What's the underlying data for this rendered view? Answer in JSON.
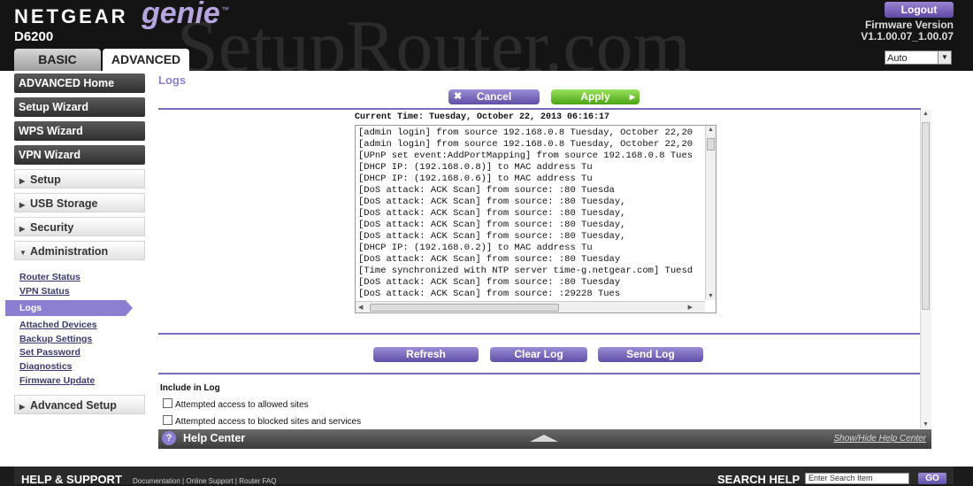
{
  "header": {
    "brand": "NETGEAR",
    "brand_product": "genie",
    "brand_tm": "™",
    "model": "D6200",
    "watermark": "SetupRouter.com",
    "tabs": [
      {
        "label": "BASIC",
        "active": false
      },
      {
        "label": "ADVANCED",
        "active": true
      }
    ],
    "logout_label": "Logout",
    "firmware_label": "Firmware Version",
    "firmware_value": "V1.1.00.07_1.00.07",
    "language_selected": "Auto"
  },
  "sidebar": {
    "primary": [
      {
        "label": "ADVANCED Home"
      },
      {
        "label": "Setup Wizard"
      },
      {
        "label": "WPS Wizard"
      },
      {
        "label": "VPN Wizard"
      }
    ],
    "sections": [
      {
        "label": "Setup",
        "expanded": false
      },
      {
        "label": "USB Storage",
        "expanded": false
      },
      {
        "label": "Security",
        "expanded": false
      },
      {
        "label": "Administration",
        "expanded": true
      }
    ],
    "admin_items": [
      {
        "label": "Router Status",
        "active": false
      },
      {
        "label": "VPN Status",
        "active": false
      },
      {
        "label": "Logs",
        "active": true
      },
      {
        "label": "Attached Devices",
        "active": false
      },
      {
        "label": "Backup Settings",
        "active": false
      },
      {
        "label": "Set Password",
        "active": false
      },
      {
        "label": "Diagnostics",
        "active": false
      },
      {
        "label": "Firmware Update",
        "active": false
      }
    ],
    "advanced_setup": {
      "label": "Advanced Setup",
      "expanded": false
    }
  },
  "content": {
    "title": "Logs",
    "cancel_label": "Cancel",
    "apply_label": "Apply",
    "current_time": "Current Time: Tuesday, October 22, 2013 06:16:17",
    "log_lines": [
      "[admin login] from source 192.168.0.8 Tuesday, October 22,20",
      "[admin login] from source 192.168.0.8 Tuesday, October 22,20",
      "[UPnP set event:AddPortMapping] from source 192.168.0.8 Tues",
      "[DHCP IP: (192.168.0.8)] to MAC address                 Tu",
      "[DHCP IP: (192.168.0.6)] to MAC address                 Tu",
      "[DoS attack: ACK Scan] from source:           :80 Tuesda",
      "[DoS attack: ACK Scan] from source:            :80 Tuesday,",
      "[DoS attack: ACK Scan] from source:          :80 Tuesday,",
      "[DoS attack: ACK Scan] from source:          :80 Tuesday,",
      "[DoS attack: ACK Scan] from source:          :80 Tuesday,",
      "[DHCP IP: (192.168.0.2)] to MAC address                 Tu",
      "[DoS attack: ACK Scan] from source:            :80 Tuesday",
      "[Time synchronized with NTP server time-g.netgear.com] Tuesd",
      "[DoS attack: ACK Scan] from source:            :80 Tuesday",
      "[DoS attack: ACK Scan] from source:           :29228 Tues"
    ],
    "refresh_label": "Refresh",
    "clear_log_label": "Clear Log",
    "send_log_label": "Send Log",
    "include_label": "Include in Log",
    "include_options": [
      {
        "label": "Attempted access to allowed sites",
        "checked": false
      },
      {
        "label": "Attempted access to blocked sites and services",
        "checked": false
      }
    ]
  },
  "help": {
    "title": "Help Center",
    "toggle_label": "Show/Hide Help Center",
    "icon": "?"
  },
  "footer": {
    "title": "HELP & SUPPORT",
    "links": "Documentation | Online Support | Router FAQ",
    "search_label": "SEARCH HELP",
    "search_value": "Enter Search Item",
    "go_label": "GO"
  },
  "colors": {
    "accent_purple": "#8c7ed0",
    "apply_green": "#4aa416",
    "header_bg": "#141414"
  }
}
